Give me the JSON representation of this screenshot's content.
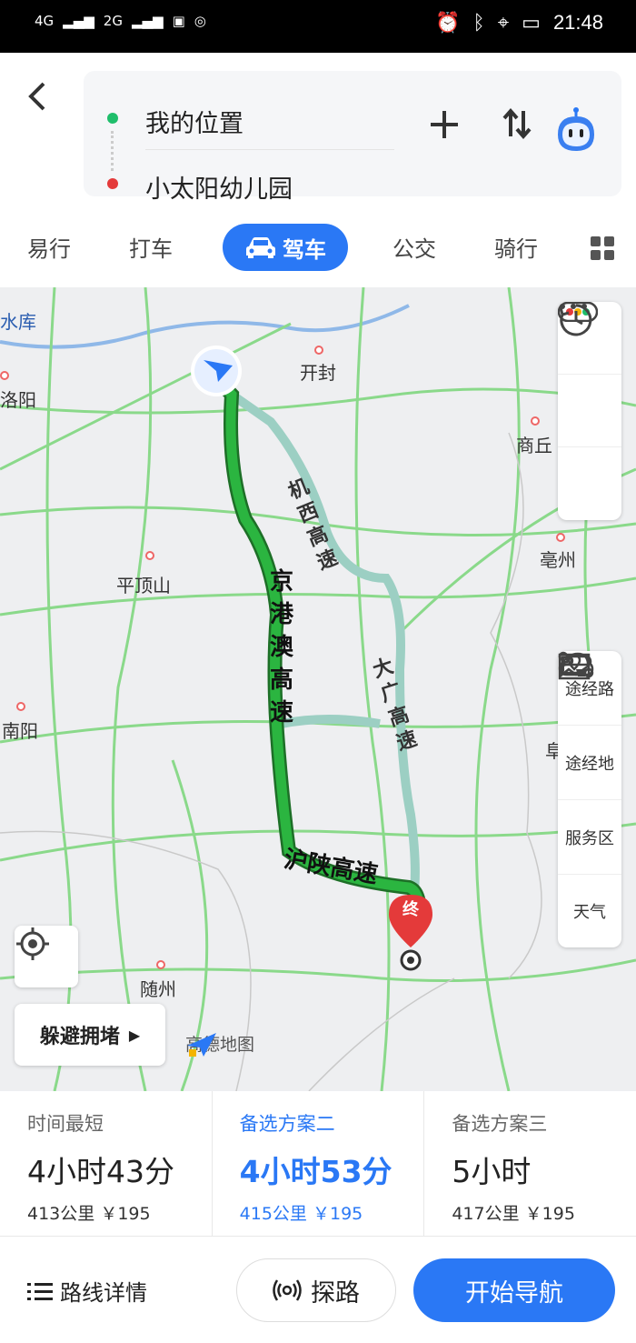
{
  "status_bar": {
    "signal_left": "4G",
    "signal_right": "2G",
    "time": "21:48"
  },
  "header": {
    "from": "我的位置",
    "to": "小太阳幼儿园"
  },
  "modes": {
    "items": [
      "易行",
      "打车",
      "驾车",
      "公交",
      "骑行"
    ],
    "active": "驾车"
  },
  "map": {
    "cities": [
      "开封",
      "商丘",
      "洛阳",
      "平顶山",
      "亳州",
      "南阳",
      "随州",
      "水库",
      "阜"
    ],
    "roads": {
      "main": "京港澳高速",
      "alt1": "机西高速",
      "alt2": "大广高速",
      "bottom": "沪陕高速"
    },
    "destination_marker": "终",
    "side_top": [
      "traffic-icon",
      "history-icon",
      "more-icon"
    ],
    "side_bottom": [
      {
        "label": "途经路",
        "icon": "waypoint-route-icon"
      },
      {
        "label": "途经地",
        "icon": "waypoint-place-icon"
      },
      {
        "label": "服务区",
        "icon": "service-area-icon"
      },
      {
        "label": "天气",
        "icon": "weather-icon"
      }
    ],
    "avoid_label": "躲避拥堵",
    "logo_text": "高德地图"
  },
  "plans": [
    {
      "title": "时间最短",
      "time": "4小时43分",
      "distance": "413公里",
      "price": "￥195"
    },
    {
      "title": "备选方案二",
      "time": "4小时53分",
      "distance": "415公里",
      "price": "￥195"
    },
    {
      "title": "备选方案三",
      "time": "5小时",
      "distance": "417公里",
      "price": "￥195"
    }
  ],
  "footer": {
    "detail_label": "路线详情",
    "probe_label": "探路",
    "start_label": "开始导航"
  },
  "colors": {
    "accent": "#2a78f5",
    "route_primary": "#1a9c2c",
    "route_alt": "#9ccfc3"
  }
}
